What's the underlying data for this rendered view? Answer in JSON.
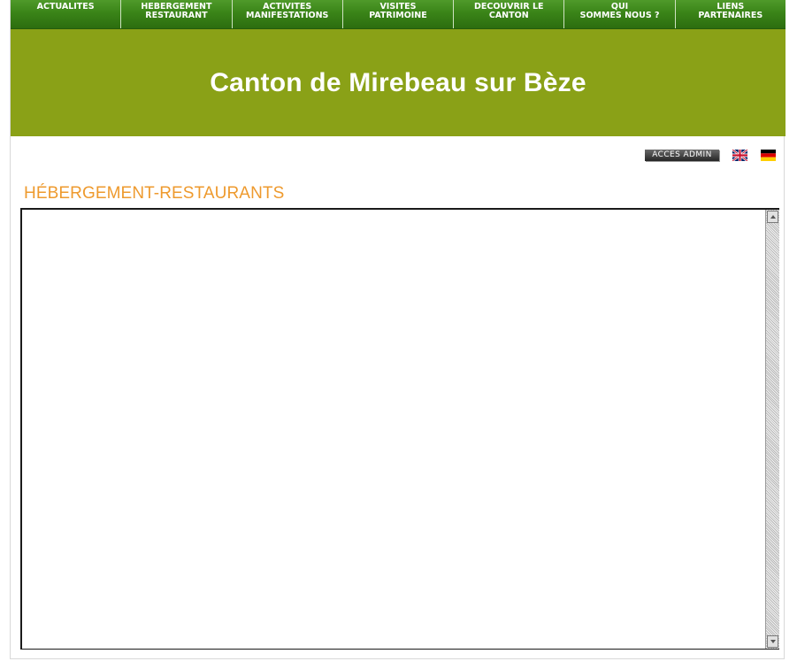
{
  "nav": {
    "items": [
      {
        "line1": "ACTUALITES",
        "line2": ""
      },
      {
        "line1": "HEBERGEMENT",
        "line2": "RESTAURANT"
      },
      {
        "line1": "ACTIVITES",
        "line2": "MANIFESTATIONS"
      },
      {
        "line1": "VISITES",
        "line2": "PATRIMOINE"
      },
      {
        "line1": "DECOUVRIR LE",
        "line2": "CANTON"
      },
      {
        "line1": "QUI",
        "line2": "SOMMES NOUS ?"
      },
      {
        "line1": "LIENS",
        "line2": "PARTENAIRES"
      }
    ]
  },
  "banner": {
    "title": "Canton de Mirebeau sur Bèze"
  },
  "toolbar": {
    "admin_label": "ACCES ADMIN",
    "flags": [
      "united-kingdom-flag-icon",
      "germany-flag-icon"
    ]
  },
  "main": {
    "section_title": "HÉBERGEMENT-RESTAURANTS"
  },
  "colors": {
    "nav_green": "#3a8418",
    "banner_olive": "#8aa117",
    "section_title_orange": "#ee9a2e"
  }
}
